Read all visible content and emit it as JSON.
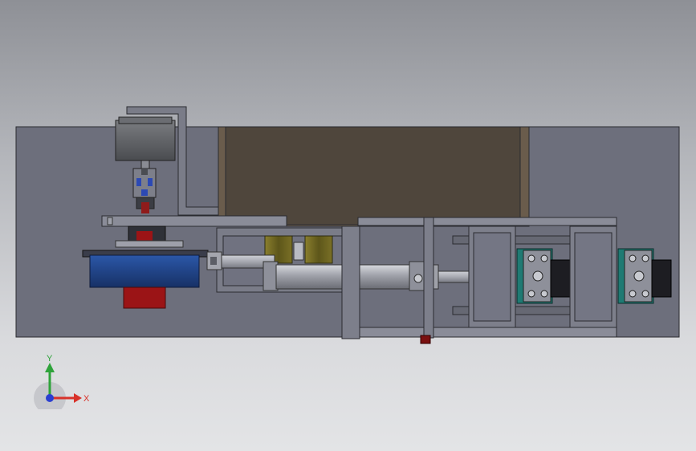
{
  "viewport": {
    "background_top": "#8e9096",
    "background_bottom": "#e3e4e6"
  },
  "triad": {
    "x_label": "X",
    "y_label": "Y",
    "x_color": "#d8322a",
    "y_color": "#2fa33b",
    "z_color": "#2b3fd1"
  },
  "colors": {
    "base_plate": "#6d6f7c",
    "back_panel": "#4f463c",
    "motor": "#5d5f62",
    "motor_flange_blue": "#1d3f86",
    "motor_red": "#9b1416",
    "cylinder_rod": "#b8bac2",
    "olive_block": "#6f6621",
    "bearing_teal": "#1f7a73",
    "dark_block": "#1d1d22"
  }
}
